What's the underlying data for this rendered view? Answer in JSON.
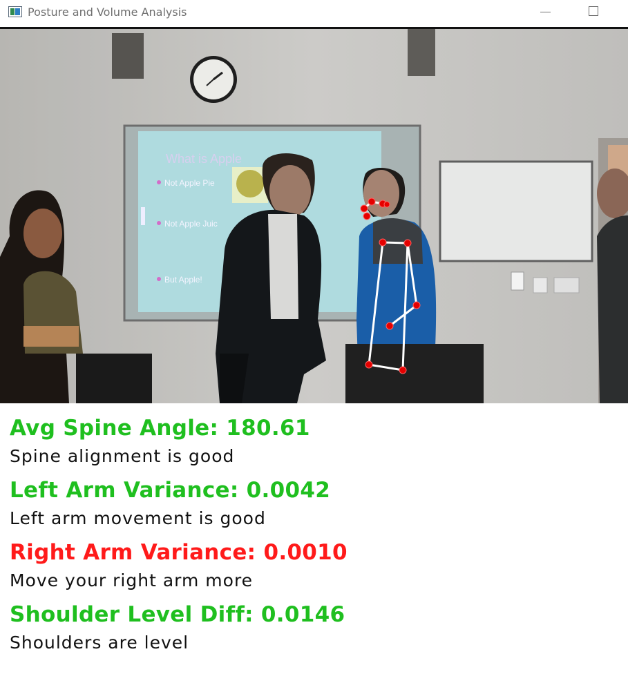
{
  "window": {
    "title": "Posture and Volume Analysis",
    "app_icon": "app-window-icon",
    "minimize_icon": "minimize-icon",
    "maximize_icon": "maximize-icon"
  },
  "video": {
    "slide_title": "What is Apple",
    "slide_bullets": [
      "Not Apple Pie",
      "Not Apple Juic",
      "But Apple!"
    ]
  },
  "metrics": [
    {
      "label": "Avg Spine Angle: 180.61",
      "message": "Spine alignment is good",
      "color": "#1fbf1f"
    },
    {
      "label": "Left Arm Variance: 0.0042",
      "message": "Left arm movement is good",
      "color": "#1fbf1f"
    },
    {
      "label": "Right Arm Variance: 0.0010",
      "message": "Move your right arm more",
      "color": "#ff1a1a"
    },
    {
      "label": "Shoulder Level Diff: 0.0146",
      "message": "Shoulders are level",
      "color": "#1fbf1f"
    }
  ],
  "skeleton_colors": {
    "joint": "#e50000",
    "bone": "#ffffff"
  }
}
